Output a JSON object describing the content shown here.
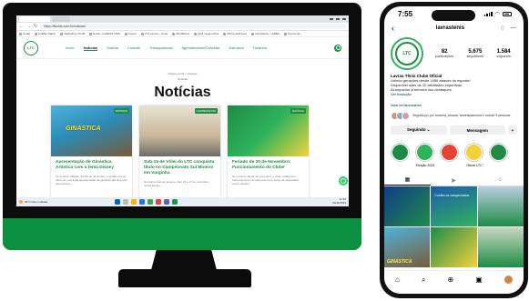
{
  "browser": {
    "url": "https://ltcclub.com.br/noticias/",
    "bookmarks": [
      "Gmail",
      "LinkBar Salton",
      "Marketing | TeVB",
      "Email - LARRAS TRIN",
      "Canva",
      "LTC Leonor - Onde",
      "WordPress",
      "Quill mega online",
      "Minha Quill Fest",
      "Labradoria - LARRA",
      "Outros fav"
    ]
  },
  "site": {
    "logo_text": "LTC",
    "nav": [
      "Início",
      "Notícias",
      "Galeria",
      "Contato",
      "Transparência",
      "Agendamento/Cancelar",
      "Estrutura",
      "Horários"
    ],
    "breadcrumb": "Página inicial > Notícias",
    "breadcrumb_sub": "Notícias",
    "page_title": "Notícias",
    "cards": [
      {
        "badge": "NOTÍCIAS",
        "overlay": "GINÁSTICA",
        "title": "Apresentação de Ginástica Artística com a tema Disney",
        "text": "No próximo sábado, dia 30 de novembro, o ginásio vai ser palco de uma linda apresentação de ginástica artística com tema Disney..."
      },
      {
        "badge": "CAMPEONATOS",
        "overlay": "",
        "title": "Sub-15 de Vôlei do LTC conquista título no Campeonato Sul Mineiro em Varginha",
        "text": "No último final de semana, dias 16 e 17 de novembro, nossa equipe..."
      },
      {
        "badge": "NOTÍCIAS",
        "overlay": "",
        "title": "Feriado de 20 de Novembro: Funcionamento do Clube",
        "text": "No próximo dia 20 de novembro, o clube estará com funcionamento normal para que o corpo de associados possa usufruir..."
      }
    ]
  },
  "taskbar": {
    "weather": "25°C Parc nublado",
    "time": "11:32",
    "date": "20/11/2024"
  },
  "phone": {
    "time": "7:55",
    "username": "lavrastenis",
    "avatar_text": "LTC",
    "stats": [
      {
        "value": "82",
        "label": "publicações"
      },
      {
        "value": "5.675",
        "label": "seguidores"
      },
      {
        "value": "1.584",
        "label": "seguindo"
      }
    ],
    "bio_name": "Lavras Tênis Clube Oficial",
    "bio_lines": [
      "Unindo gerações desde 1950 através do esporte!",
      "Disponível mais de 10 atividades esportivas",
      "Acompanhe a reforma nos destaques"
    ],
    "bio_more": "Ver tradução",
    "link": "linktr.ee/lavrastenis",
    "followed_by": "Seguido(a) por andreia_amaral, tamirispalmeira e outras 9 pessoas",
    "actions": [
      "Seguindo ⌄",
      "Mensagem"
    ],
    "highlights": [
      "",
      "Eleição 2024",
      "",
      "Obras LTC",
      ""
    ],
    "posts": [
      {
        "caption": "",
        "text": ""
      },
      {
        "caption": "",
        "text": "Confira os campeonatos"
      },
      {
        "caption": "",
        "text": ""
      },
      {
        "caption": "GINÁSTICA",
        "text": ""
      },
      {
        "caption": "",
        "text": ""
      },
      {
        "caption": "",
        "text": ""
      }
    ]
  }
}
